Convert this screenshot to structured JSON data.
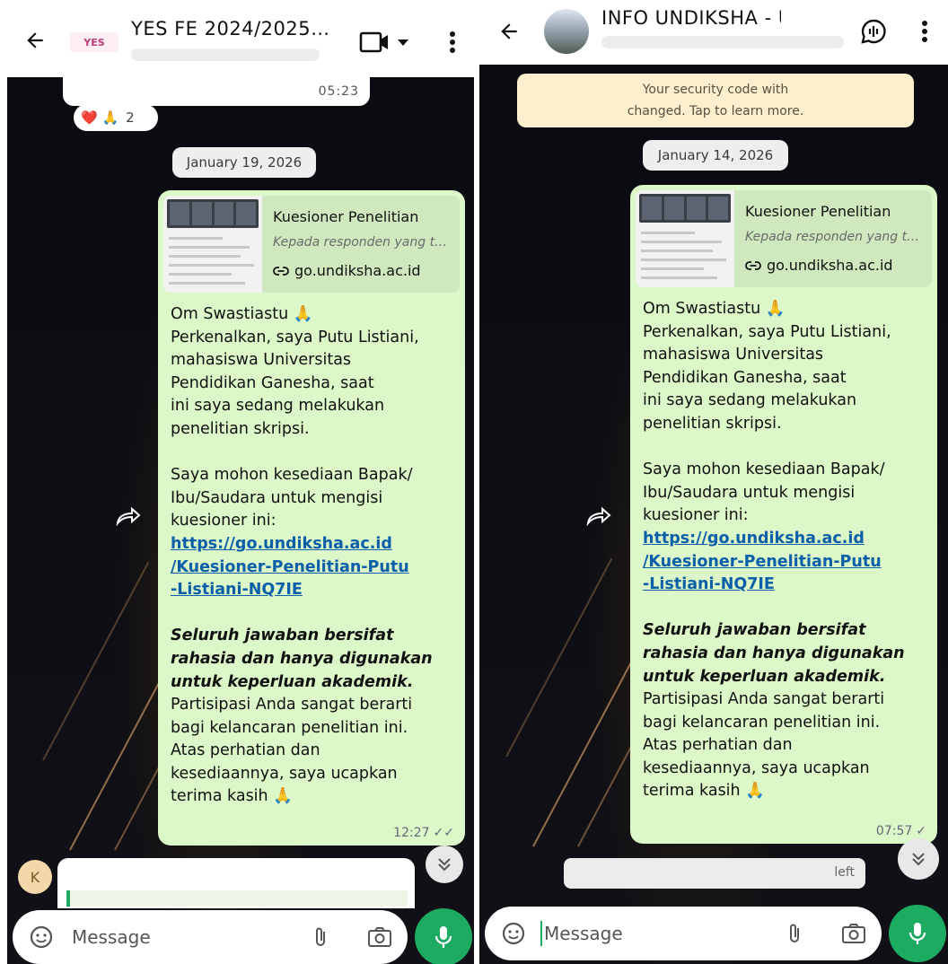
{
  "left": {
    "header": {
      "title": "YES FE 2024/2025…",
      "logo_text": "YES"
    },
    "prev_message_time": "05:23",
    "reactions": {
      "emojis": "❤️ 🙏",
      "count": "2"
    },
    "date": "January 19, 2026",
    "message": {
      "preview_title": "Kuesioner Penelitian",
      "preview_desc": "Kepada responden yang t…",
      "preview_link": "go.undiksha.ac.id",
      "greeting": "Om Swastiastu 🙏",
      "p1": [
        "Perkenalkan, saya Putu Listiani,",
        "mahasiswa Universitas",
        "Pendidikan Ganesha, saat",
        "ini saya sedang melakukan",
        "penelitian  skripsi."
      ],
      "p2": [
        "Saya mohon kesediaan Bapak/",
        "Ibu/Saudara untuk mengisi",
        "kuesioner ini:"
      ],
      "link": [
        "https://go.undiksha.ac.id",
        "/Kuesioner-Penelitian-Putu",
        "-Listiani-NQ7IE"
      ],
      "bold": [
        "Seluruh jawaban bersifat",
        "rahasia dan hanya digunakan",
        "untuk keperluan akademik."
      ],
      "p3": [
        "Partisipasi Anda sangat berarti",
        "bagi kelancaran penelitian ini.",
        "Atas perhatian dan",
        "kesediaannya, saya ucapkan"
      ],
      "closing": "terima kasih 🙏",
      "time": "12:27",
      "ticks": "✓✓"
    },
    "avatar_letter": "K",
    "composer": {
      "placeholder": "Message"
    }
  },
  "right": {
    "header": {
      "title": "INFO UNDIKSHA - UNOF…"
    },
    "security": {
      "line1": "Your security code with",
      "line2": "changed. Tap to learn more."
    },
    "date": "January 14, 2026",
    "message": {
      "preview_title": "Kuesioner Penelitian",
      "preview_desc": "Kepada responden yang t…",
      "preview_link": "go.undiksha.ac.id",
      "greeting": "Om Swastiastu 🙏",
      "p1": [
        "Perkenalkan, saya Putu Listiani,",
        "mahasiswa Universitas",
        "Pendidikan Ganesha, saat",
        "ini saya sedang melakukan",
        "penelitian  skripsi."
      ],
      "p2": [
        "Saya mohon kesediaan Bapak/",
        "Ibu/Saudara untuk mengisi",
        "kuesioner ini:"
      ],
      "link": [
        "https://go.undiksha.ac.id",
        "/Kuesioner-Penelitian-Putu",
        "-Listiani-NQ7IE"
      ],
      "bold": [
        "Seluruh jawaban bersifat",
        "rahasia dan hanya digunakan",
        "untuk keperluan akademik."
      ],
      "p3": [
        "Partisipasi Anda sangat berarti",
        "bagi kelancaran penelitian ini.",
        "Atas perhatian dan",
        "kesediaannya, saya ucapkan"
      ],
      "closing": "terima kasih 🙏",
      "time": "07:57",
      "ticks": "✓"
    },
    "system_notice": "left",
    "composer": {
      "placeholder": "Message"
    }
  },
  "colors": {
    "bubble": "#dcf7c8",
    "accent": "#1daa61",
    "link": "#0b5fa8"
  },
  "icons": [
    "back-arrow-icon",
    "video-call-icon",
    "more-options-icon",
    "voice-chat-icon",
    "link-icon",
    "double-check-icon",
    "forward-icon",
    "scroll-down-icon",
    "sticker-icon",
    "attach-icon",
    "camera-icon",
    "mic-icon"
  ]
}
